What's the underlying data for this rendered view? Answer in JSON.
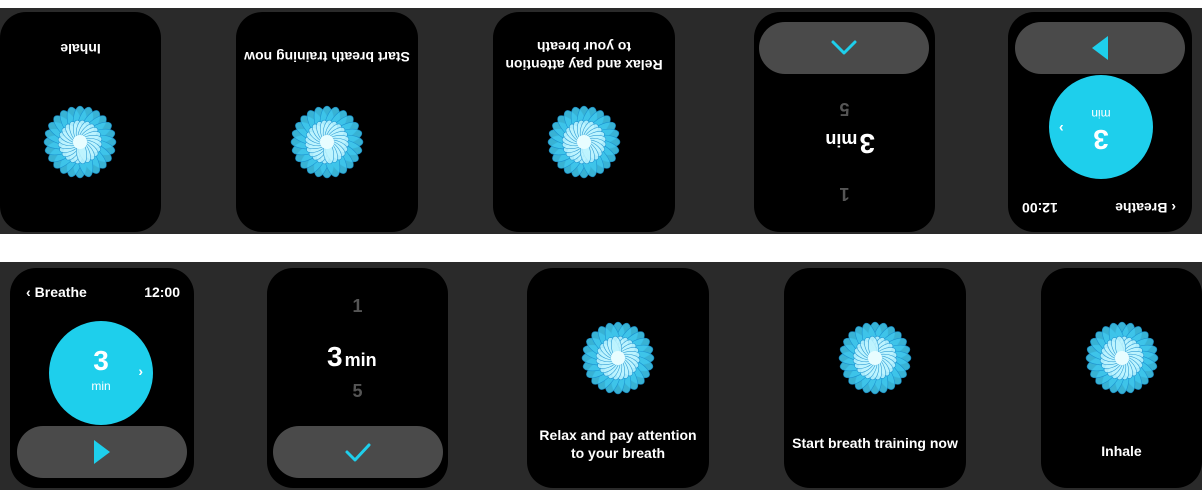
{
  "breathe": {
    "back_label": "Breathe",
    "time": "12:00",
    "duration_value": "3",
    "duration_unit": "min"
  },
  "picker": {
    "prev_value": "1",
    "current_value": "3",
    "current_unit": "min",
    "next_value": "5"
  },
  "messages": {
    "relax": "Relax and pay attention to your breath",
    "start": "Start breath training now",
    "inhale": "Inhale"
  },
  "icons": {
    "back": "chevron-left-icon",
    "next": "chevron-right-icon",
    "play": "play-icon",
    "up": "chevron-up-icon",
    "confirm": "check-icon",
    "flower": "flower-icon"
  },
  "colors": {
    "accent": "#1ecfec",
    "screen": "#000000",
    "panel": "#2a2a2a",
    "button": "#4a4a4a"
  }
}
